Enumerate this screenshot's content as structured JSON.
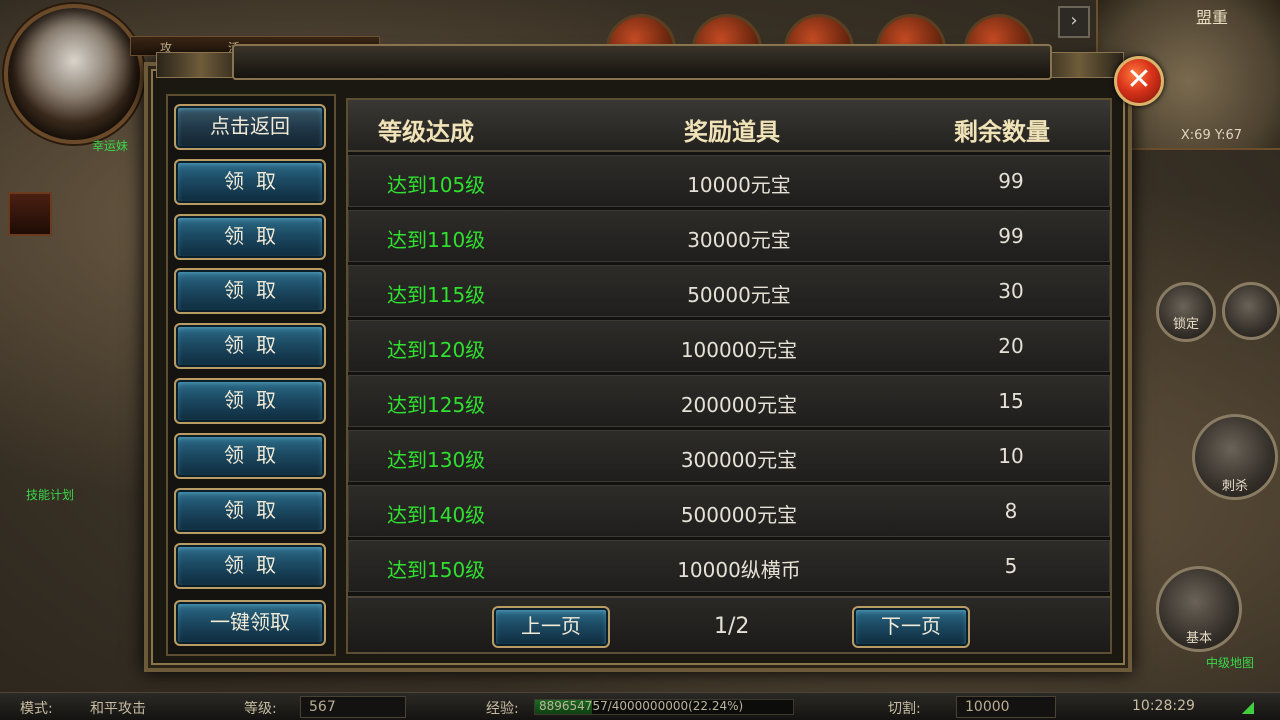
{
  "hud": {
    "player_name": "幸运妹",
    "top_tabs": "攻 活",
    "minimap_title": "盟重",
    "minimap_coords": "X:69 Y:67",
    "lock_label": "锁定",
    "thrust_label": "刺杀",
    "basic_label": "基本",
    "map_label": "中级地图",
    "npc_label": "技能计划",
    "arrow_icon": "chevron-right-icon"
  },
  "status_bar": {
    "mode_label": "模式:",
    "mode_value": "和平攻击",
    "level_label": "等级:",
    "level_value": "567",
    "exp_label": "经验:",
    "exp_value": "889654757/4000000000(22.24%)",
    "exp_fraction": 0.2224,
    "cut_label": "切割:",
    "cut_value": "10000",
    "time": "10:28:29"
  },
  "dialog": {
    "back_button": "点击返回",
    "claim_all_button": "一键领取",
    "claim_label": "领取",
    "headers": [
      "等级达成",
      "奖励道具",
      "剩余数量"
    ],
    "rows": [
      {
        "level": "达到105级",
        "reward": "10000元宝",
        "remaining": "99"
      },
      {
        "level": "达到110级",
        "reward": "30000元宝",
        "remaining": "99"
      },
      {
        "level": "达到115级",
        "reward": "50000元宝",
        "remaining": "30"
      },
      {
        "level": "达到120级",
        "reward": "100000元宝",
        "remaining": "20"
      },
      {
        "level": "达到125级",
        "reward": "200000元宝",
        "remaining": "15"
      },
      {
        "level": "达到130级",
        "reward": "300000元宝",
        "remaining": "10"
      },
      {
        "level": "达到140级",
        "reward": "500000元宝",
        "remaining": "8"
      },
      {
        "level": "达到150级",
        "reward": "10000纵横币",
        "remaining": "5"
      }
    ],
    "prev_page": "上一页",
    "next_page": "下一页",
    "page_indicator": "1/2",
    "close_icon": "close-icon"
  },
  "colors": {
    "level_text": "#2fe02f",
    "header_text": "#f1e3b8",
    "button_blue": "#1c4a63",
    "close_red": "#d8321a"
  }
}
